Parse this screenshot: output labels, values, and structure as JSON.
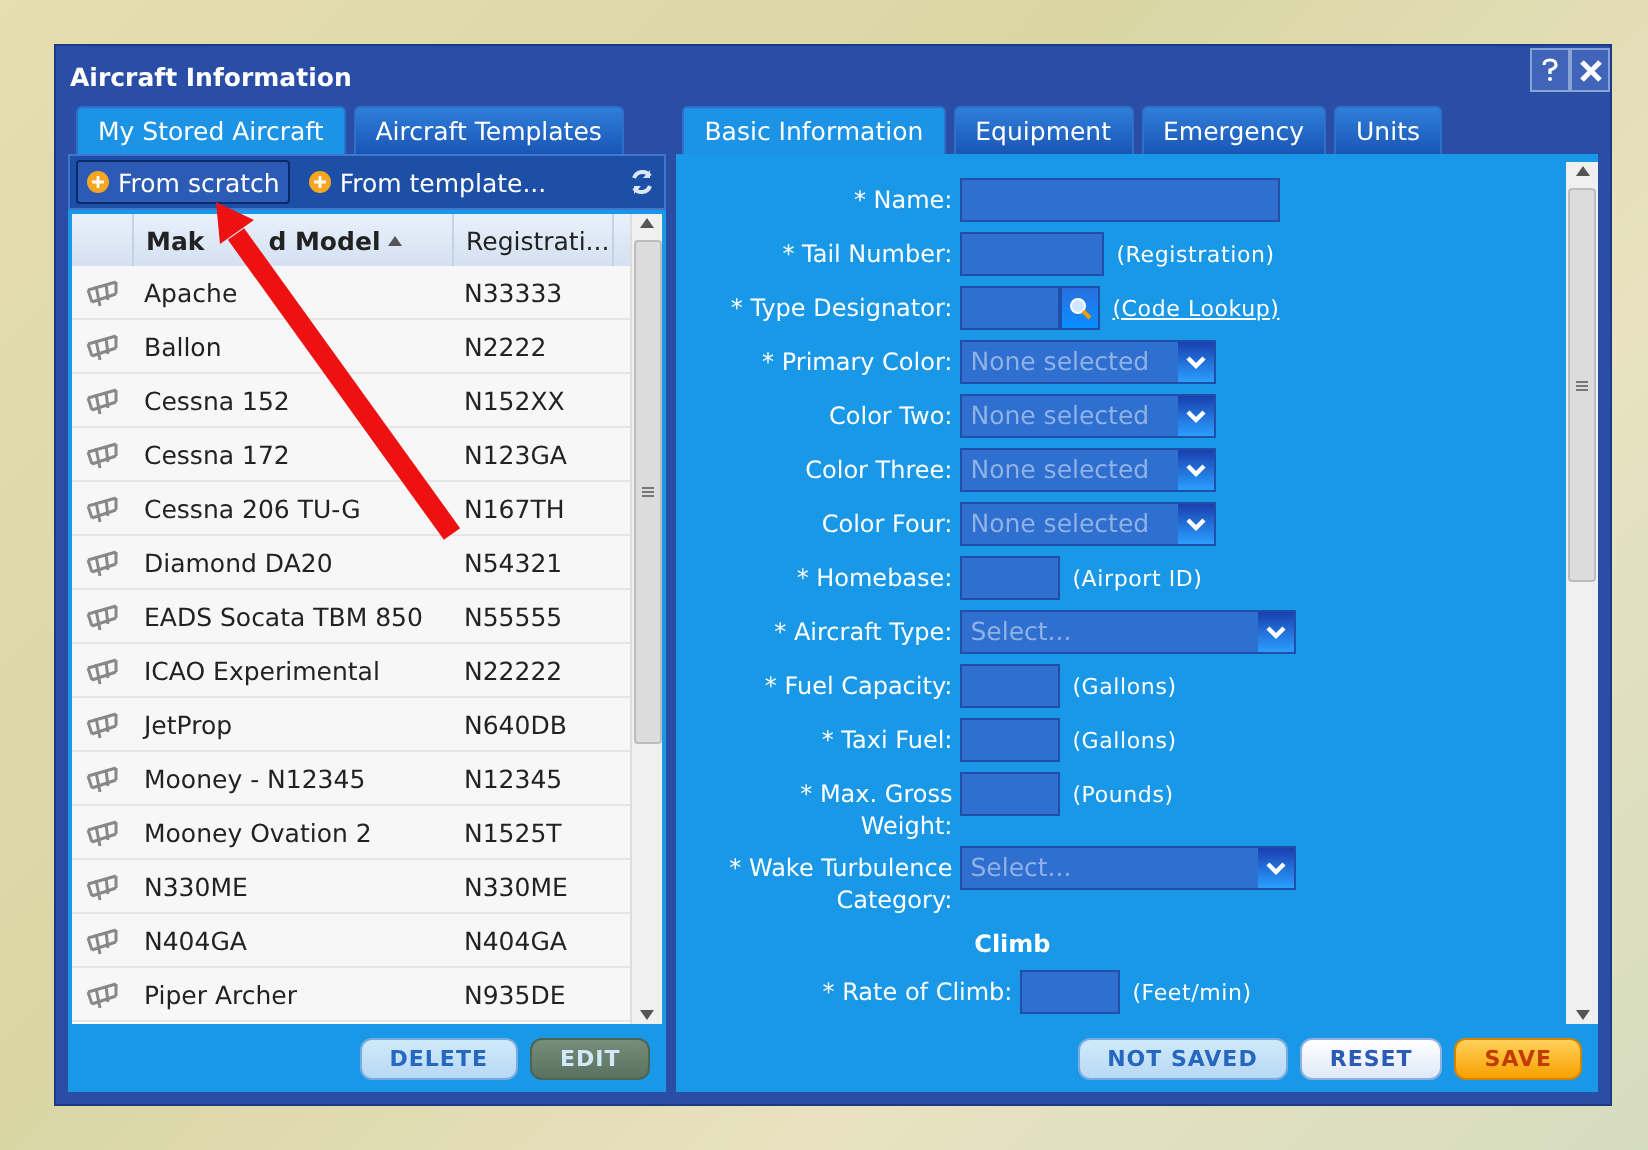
{
  "window": {
    "title": "Aircraft Information"
  },
  "left_panel": {
    "tabs": [
      {
        "label": "My Stored Aircraft",
        "selected": true
      },
      {
        "label": "Aircraft Templates",
        "selected": false
      }
    ],
    "toolbar": [
      {
        "label": "From scratch",
        "selected": true
      },
      {
        "label": "From template...",
        "selected": false
      }
    ],
    "table": {
      "columns": [
        {
          "label": "Mak",
          "label_after_arrow": "d Model",
          "sorted": true
        },
        {
          "label": "Registrati...",
          "sorted": false
        }
      ],
      "rows": [
        {
          "model": "Apache",
          "registration": "N33333"
        },
        {
          "model": "Ballon",
          "registration": "N2222"
        },
        {
          "model": "Cessna 152",
          "registration": "N152XX"
        },
        {
          "model": "Cessna 172",
          "registration": "N123GA"
        },
        {
          "model": "Cessna 206 TU-G",
          "registration": "N167TH"
        },
        {
          "model": "Diamond DA20",
          "registration": "N54321"
        },
        {
          "model": "EADS Socata TBM 850",
          "registration": "N55555"
        },
        {
          "model": "ICAO Experimental",
          "registration": "N22222"
        },
        {
          "model": "JetProp",
          "registration": "N640DB"
        },
        {
          "model": "Mooney - N12345",
          "registration": "N12345"
        },
        {
          "model": "Mooney Ovation 2",
          "registration": "N1525T"
        },
        {
          "model": "N330ME",
          "registration": "N330ME"
        },
        {
          "model": "N404GA",
          "registration": "N404GA"
        },
        {
          "model": "Piper Archer",
          "registration": "N935DE"
        }
      ]
    },
    "buttons": [
      {
        "label": "DELETE",
        "kind": "plain",
        "disabled": true
      },
      {
        "label": "EDIT",
        "kind": "accent",
        "disabled": true
      }
    ]
  },
  "right_panel": {
    "tabs": [
      {
        "label": "Basic Information",
        "selected": true
      },
      {
        "label": "Equipment",
        "selected": false
      },
      {
        "label": "Emergency",
        "selected": false
      },
      {
        "label": "Units",
        "selected": false
      }
    ],
    "form": [
      {
        "kind": "field",
        "label": "* Name:",
        "control": {
          "kind": "widetext"
        }
      },
      {
        "kind": "field",
        "label": "* Tail Number:",
        "control": {
          "kind": "text"
        },
        "hint": "(Registration)"
      },
      {
        "kind": "field",
        "label": "* Type Designator:",
        "control": {
          "kind": "lookup"
        },
        "link": "(Code Lookup)"
      },
      {
        "kind": "field",
        "label": "* Primary Color:",
        "control": {
          "kind": "select",
          "placeholder": "None selected"
        }
      },
      {
        "kind": "field",
        "label": "Color Two:",
        "control": {
          "kind": "select",
          "placeholder": "None selected"
        }
      },
      {
        "kind": "field",
        "label": "Color Three:",
        "control": {
          "kind": "select",
          "placeholder": "None selected"
        }
      },
      {
        "kind": "field",
        "label": "Color Four:",
        "control": {
          "kind": "select",
          "placeholder": "None selected"
        }
      },
      {
        "kind": "field",
        "label": "* Homebase:",
        "control": {
          "kind": "shorttext"
        },
        "hint": "(Airport ID)"
      },
      {
        "kind": "field",
        "label": "* Aircraft Type:",
        "control": {
          "kind": "wideselect",
          "placeholder": "Select..."
        }
      },
      {
        "kind": "field",
        "label": "* Fuel Capacity:",
        "control": {
          "kind": "shorttext"
        },
        "hint": "(Gallons)"
      },
      {
        "kind": "field",
        "label": "* Taxi Fuel:",
        "control": {
          "kind": "shorttext"
        },
        "hint": "(Gallons)"
      },
      {
        "kind": "field",
        "label": "* Max. Gross Weight:",
        "control": {
          "kind": "shorttext"
        },
        "hint": "(Pounds)"
      },
      {
        "kind": "field",
        "label": "* Wake Turbulence Category:",
        "control": {
          "kind": "wideselect",
          "placeholder": "Select..."
        }
      },
      {
        "kind": "heading",
        "label": "Climb"
      },
      {
        "kind": "subfield",
        "label": "* Rate of Climb:",
        "control": {
          "kind": "shorttext"
        },
        "hint": "(Feet/min)"
      }
    ],
    "buttons": [
      {
        "label": "NOT SAVED",
        "kind": "plain",
        "disabled": true
      },
      {
        "label": "RESET",
        "kind": "plain",
        "disabled": false
      },
      {
        "label": "SAVE",
        "kind": "primary",
        "disabled": false
      }
    ]
  }
}
